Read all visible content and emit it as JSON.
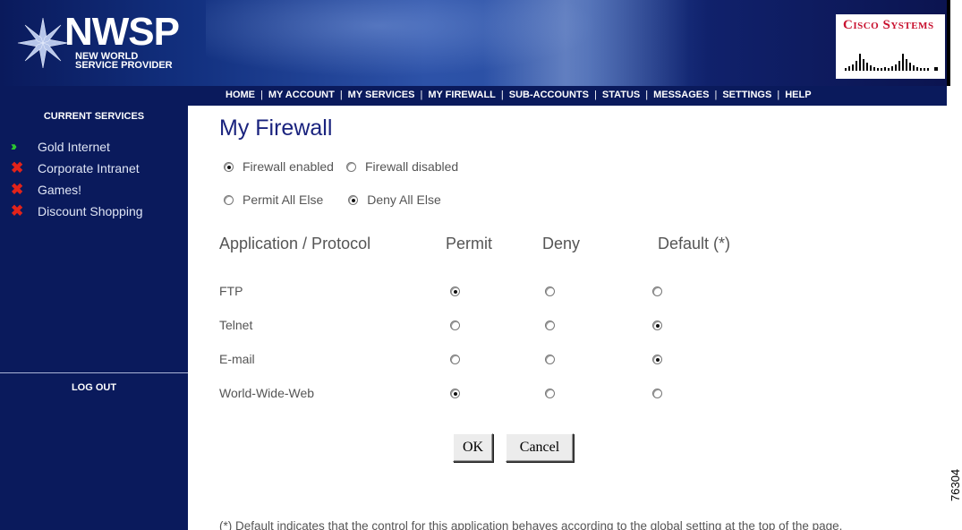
{
  "banner": {
    "logo_title": "NWSP",
    "logo_line1": "NEW WORLD",
    "logo_line2": "SERVICE PROVIDER",
    "cisco_name": "Cisco Systems"
  },
  "nav": {
    "items": [
      "HOME",
      "MY ACCOUNT",
      "MY SERVICES",
      "MY FIREWALL",
      "SUB-ACCOUNTS",
      "STATUS",
      "MESSAGES",
      "SETTINGS",
      "HELP"
    ],
    "separator": "|"
  },
  "sidebar": {
    "title": "CURRENT SERVICES",
    "services": [
      {
        "label": "Gold Internet",
        "status": "active",
        "icon": "green-chevron-icon"
      },
      {
        "label": "Corporate Intranet",
        "status": "inactive",
        "icon": "red-x-icon"
      },
      {
        "label": "Games!",
        "status": "inactive",
        "icon": "red-x-icon"
      },
      {
        "label": "Discount Shopping",
        "status": "inactive",
        "icon": "red-x-icon"
      }
    ],
    "logout": "LOG OUT"
  },
  "main": {
    "title": "My Firewall",
    "firewall_enabled_label": "Firewall enabled",
    "firewall_disabled_label": "Firewall disabled",
    "firewall_state": "enabled",
    "permit_all_label": "Permit All Else",
    "deny_all_label": "Deny All Else",
    "global_policy": "deny",
    "columns": [
      "Application / Protocol",
      "Permit",
      "Deny",
      "Default (*)"
    ],
    "applications": [
      {
        "name": "FTP",
        "selected": "permit"
      },
      {
        "name": "Telnet",
        "selected": "default"
      },
      {
        "name": "E-mail",
        "selected": "default"
      },
      {
        "name": "World-Wide-Web",
        "selected": "permit"
      }
    ],
    "ok_label": "OK",
    "cancel_label": "Cancel",
    "footnote": "(*) Default indicates that the control for this application behaves according to the global setting at the top of the page."
  },
  "figure_id": "76304",
  "colors": {
    "nav_bg": "#0a1a5c",
    "title": "#1a237e",
    "active_icon": "#2fd22f",
    "inactive_icon": "#e2231a",
    "cisco_red": "#c8102e"
  }
}
